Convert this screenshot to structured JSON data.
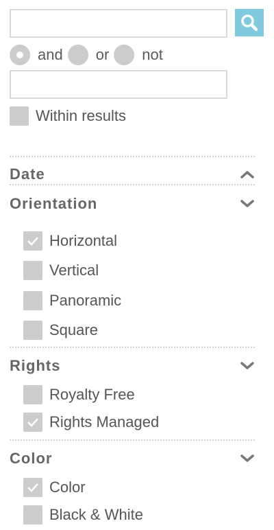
{
  "search": {
    "value": "",
    "placeholder": "",
    "icon": "search-icon",
    "button_color": "#7fcadf"
  },
  "operators": [
    {
      "label": "and",
      "selected": true
    },
    {
      "label": "or",
      "selected": false
    },
    {
      "label": "not",
      "selected": false
    }
  ],
  "secondary_search": {
    "value": "",
    "placeholder": ""
  },
  "within_results": {
    "label": "Within results",
    "checked": false
  },
  "sections": {
    "date": {
      "title": "Date",
      "expanded": true,
      "icon": "chevron-up-icon"
    },
    "orientation": {
      "title": "Orientation",
      "expanded": false,
      "icon": "chevron-down-icon",
      "options": [
        {
          "label": "Horizontal",
          "checked": true
        },
        {
          "label": "Vertical",
          "checked": false
        },
        {
          "label": "Panoramic",
          "checked": false
        },
        {
          "label": "Square",
          "checked": false
        }
      ]
    },
    "rights": {
      "title": "Rights",
      "expanded": false,
      "icon": "chevron-down-icon",
      "options": [
        {
          "label": "Royalty Free",
          "checked": false
        },
        {
          "label": "Rights Managed",
          "checked": true
        }
      ]
    },
    "color": {
      "title": "Color",
      "expanded": false,
      "icon": "chevron-down-icon",
      "options": [
        {
          "label": "Color",
          "checked": true
        },
        {
          "label": "Black & White",
          "checked": false
        }
      ]
    }
  }
}
